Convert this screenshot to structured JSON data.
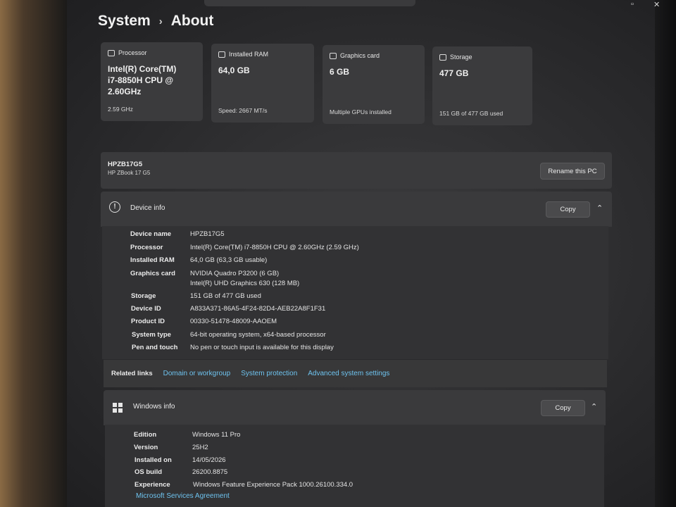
{
  "window": {
    "maximize_glyph": "▫",
    "close_glyph": "✕"
  },
  "breadcrumb": {
    "parent": "System",
    "separator": "›",
    "current": "About"
  },
  "cards": [
    {
      "title": "Processor",
      "value": "Intel(R) Core(TM) i7-8850H CPU @ 2.60GHz",
      "sub": "2.59 GHz",
      "icon": "processor-icon"
    },
    {
      "title": "Installed RAM",
      "value": "64,0 GB",
      "sub": "Speed: 2667 MT/s",
      "icon": "ram-icon"
    },
    {
      "title": "Graphics card",
      "value": "6 GB",
      "sub": "Multiple GPUs installed",
      "icon": "graphics-card-icon"
    },
    {
      "title": "Storage",
      "value": "477 GB",
      "sub": "151 GB of 477 GB used",
      "icon": "storage-icon"
    }
  ],
  "pc": {
    "name": "HPZB17G5",
    "model": "HP ZBook 17 G5",
    "rename_label": "Rename this PC"
  },
  "device_info": {
    "title": "Device info",
    "copy_label": "Copy",
    "info_glyph": "!",
    "chevron": "⌃",
    "rows": [
      {
        "key": "Device name",
        "value": "HPZB17G5"
      },
      {
        "key": "Processor",
        "value": "Intel(R) Core(TM) i7-8850H CPU @ 2.60GHz (2.59 GHz)"
      },
      {
        "key": "Installed RAM",
        "value": "64,0 GB (63,3 GB usable)"
      },
      {
        "key": "Graphics card",
        "value": "NVIDIA Quadro P3200 (6 GB)",
        "value2": "Intel(R) UHD Graphics 630 (128 MB)"
      },
      {
        "key": "Storage",
        "value": "151 GB of 477 GB used"
      },
      {
        "key": "Device ID",
        "value": "A833A371-86A5-4F24-82D4-AEB22A8F1F31"
      },
      {
        "key": "Product ID",
        "value": "00330-51478-48009-AAOEM"
      },
      {
        "key": "System type",
        "value": "64-bit operating system, x64-based processor"
      },
      {
        "key": "Pen and touch",
        "value": "No pen or touch input is available for this display"
      }
    ]
  },
  "related_links": {
    "label": "Related links",
    "links": [
      "Domain or workgroup",
      "System protection",
      "Advanced system settings"
    ]
  },
  "windows_info": {
    "title": "Windows info",
    "copy_label": "Copy",
    "chevron": "⌃",
    "rows": [
      {
        "key": "Edition",
        "value": "Windows 11 Pro"
      },
      {
        "key": "Version",
        "value": "25H2"
      },
      {
        "key": "Installed on",
        "value": "14/05/2026"
      },
      {
        "key": "OS build",
        "value": "26200.8875"
      },
      {
        "key": "Experience",
        "value": "Windows Feature Experience Pack 1000.26100.334.0"
      }
    ],
    "ms_link": "Microsoft Services Agreement"
  },
  "colors": {
    "accent_link": "#6ec3ef",
    "card_bg": "#3b3b3d",
    "panel_bg": "#323234"
  }
}
